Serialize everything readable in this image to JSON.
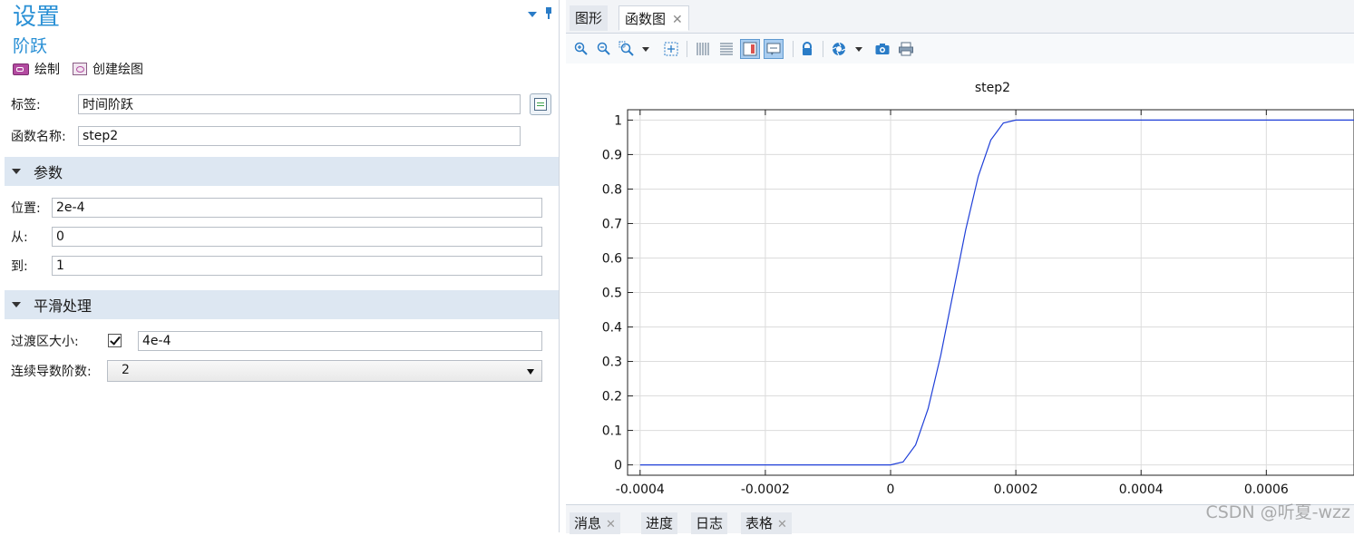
{
  "settings": {
    "title": "设置",
    "subtitle": "阶跃",
    "actions": {
      "plot": "绘制",
      "create_plot": "创建绘图"
    },
    "label_field": {
      "label": "标签:",
      "value": "时间阶跃"
    },
    "name_field": {
      "label": "函数名称:",
      "value": "step2"
    },
    "params_section": "参数",
    "location": {
      "label": "位置:",
      "value": "2e-4"
    },
    "from": {
      "label": "从:",
      "value": "0"
    },
    "to": {
      "label": "到:",
      "value": "1"
    },
    "smoothing_section": "平滑处理",
    "transition": {
      "label": "过渡区大小:",
      "checked": true,
      "value": "4e-4"
    },
    "continuity": {
      "label": "连续导数阶数:",
      "value": "2"
    }
  },
  "graphics": {
    "tabs": [
      {
        "label": "图形",
        "active": false
      },
      {
        "label": "函数图",
        "active": true,
        "closable": true
      }
    ],
    "toolbar_icons": [
      "zoom-in-icon",
      "zoom-out-icon",
      "zoom-box-icon",
      "zoom-extents-icon",
      "x-grid-icon",
      "y-grid-icon",
      "legend-icon",
      "tooltip-icon",
      "lock-icon",
      "image-snapshot-icon",
      "camera-icon",
      "print-icon"
    ],
    "bottom_tabs": [
      {
        "label": "消息",
        "closable": true
      },
      {
        "label": "进度"
      },
      {
        "label": "日志"
      },
      {
        "label": "表格",
        "closable": true
      }
    ]
  },
  "watermark": "CSDN @听夏-wzz",
  "colors": {
    "accent": "#2a90d5",
    "section_bg": "#dde7f2",
    "curve": "#1f3fd8",
    "grid": "#dcdcdc"
  },
  "chart_data": {
    "type": "line",
    "title": "step2",
    "xlabel": "",
    "ylabel": "",
    "xlim": [
      -0.00042,
      0.00074
    ],
    "ylim": [
      -0.03,
      1.03
    ],
    "xticks": [
      -0.0004,
      -0.0002,
      0,
      0.0002,
      0.0004,
      0.0006
    ],
    "xtick_labels": [
      "-0.0004",
      "-0.0002",
      "0",
      "0.0002",
      "0.0004",
      "0.0006"
    ],
    "yticks": [
      0,
      0.1,
      0.2,
      0.3,
      0.4,
      0.5,
      0.6,
      0.7,
      0.8,
      0.9,
      1
    ],
    "ytick_labels": [
      "0",
      "0.1",
      "0.2",
      "0.3",
      "0.4",
      "0.5",
      "0.6",
      "0.7",
      "0.8",
      "0.9",
      "1"
    ],
    "grid": true,
    "series": [
      {
        "x": [
          -0.0004,
          -0.0003,
          -0.0002,
          -0.0001,
          0,
          2e-05,
          4e-05,
          6e-05,
          8e-05,
          0.0001,
          0.00012,
          0.00014,
          0.00016,
          0.00018,
          0.0002,
          0.00022,
          0.00024,
          0.00026,
          0.00028,
          0.0003,
          0.00032,
          0.00034,
          0.00036,
          0.00038,
          0.0004,
          0.0005,
          0.0006,
          0.0007,
          0.00074
        ],
        "y": [
          0,
          0,
          0,
          0,
          0,
          0.0086,
          0.0579,
          0.1631,
          0.3174,
          0.5,
          0.6826,
          0.8369,
          0.9421,
          0.9914,
          1,
          1,
          1,
          1,
          1,
          1,
          1,
          1,
          1,
          1,
          1,
          1,
          1,
          1,
          1
        ]
      }
    ]
  }
}
